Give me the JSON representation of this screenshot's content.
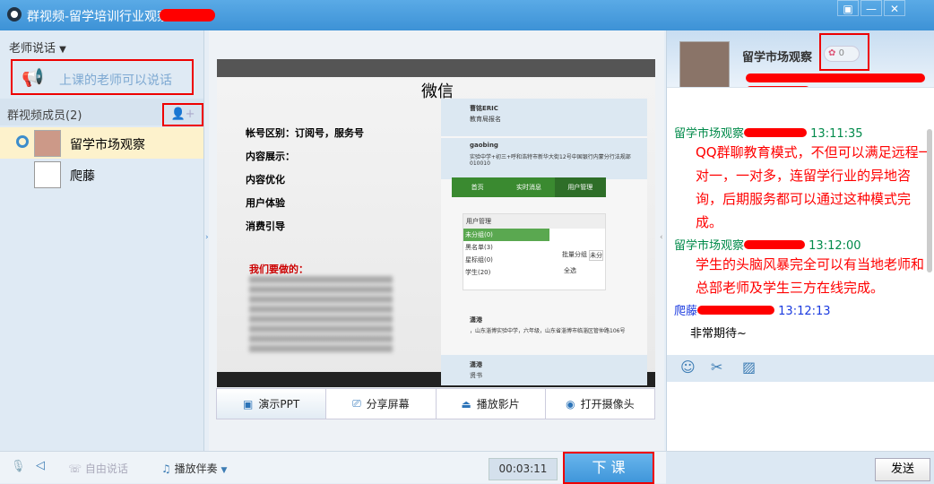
{
  "window": {
    "title": "群视频-留学培训行业观察",
    "controls": [
      "▣",
      "—",
      "✕"
    ]
  },
  "left": {
    "mode_label": "老师说话",
    "banner": "上课的老师可以说话",
    "members_label": "群视频成员(2)",
    "members": [
      {
        "name": "留学市场观察"
      },
      {
        "name": "爬藤"
      }
    ]
  },
  "slide": {
    "brand": "微信",
    "lines": [
      "帐号区别：订阅号，服务号",
      "内容展示：",
      "内容优化",
      "用户体验",
      "消费引导"
    ],
    "todo_title": "我们要做的：",
    "phone": {
      "user1": "曹铭ERIC",
      "user1_sub": "教育局报名",
      "user2": "gaobing",
      "user2_addr": "实验中学+初三+呼和浩特市新华大街12号中国银行内蒙分行法规部010010",
      "nav": [
        "首页",
        "实时消息",
        "用户管理"
      ],
      "menu_title": "用户管理",
      "menu": [
        "未分组(0)",
        "黑名单(3)",
        "星标组(0)",
        "学生(20)"
      ],
      "batch": "批量分组",
      "batch_sel": "未分",
      "select_all": "全选",
      "user3": "潇港",
      "user3_addr": "，山东淄博实验中学，六年级，山东省淄博市临淄区管仲路106号",
      "user4": "潇港",
      "user4_sub": "贤书"
    }
  },
  "tabs": [
    {
      "label": "演示PPT",
      "icon": "ppt-icon"
    },
    {
      "label": "分享屏幕",
      "icon": "share-screen-icon"
    },
    {
      "label": "播放影片",
      "icon": "play-movie-icon"
    },
    {
      "label": "打开摄像头",
      "icon": "camera-icon"
    }
  ],
  "bottom": {
    "free_talk": "自由说话",
    "music": "播放伴奏",
    "timer": "00:03:11",
    "end_class": "下 课",
    "send": "发送"
  },
  "profile": {
    "name": "留学市场观察",
    "flowers": "0"
  },
  "chat": [
    {
      "sender": "留学市场观察",
      "time": "13:11:35",
      "text": "QQ群聊教育模式，不但可以满足远程一对一，一对多，连留学行业的异地咨询，后期服务都可以通过这种模式完成。",
      "color": "#008a4a",
      "text_color": "#ff0000"
    },
    {
      "sender": "留学市场观察",
      "time": "13:12:00",
      "text": "学生的头脑风暴完全可以有当地老师和总部老师及学生三方在线完成。",
      "color": "#008a4a",
      "text_color": "#ff0000"
    },
    {
      "sender": "爬藤",
      "time": "13:12:13",
      "text": "非常期待~",
      "color": "#1a3adf",
      "text_color": "#000000"
    }
  ]
}
